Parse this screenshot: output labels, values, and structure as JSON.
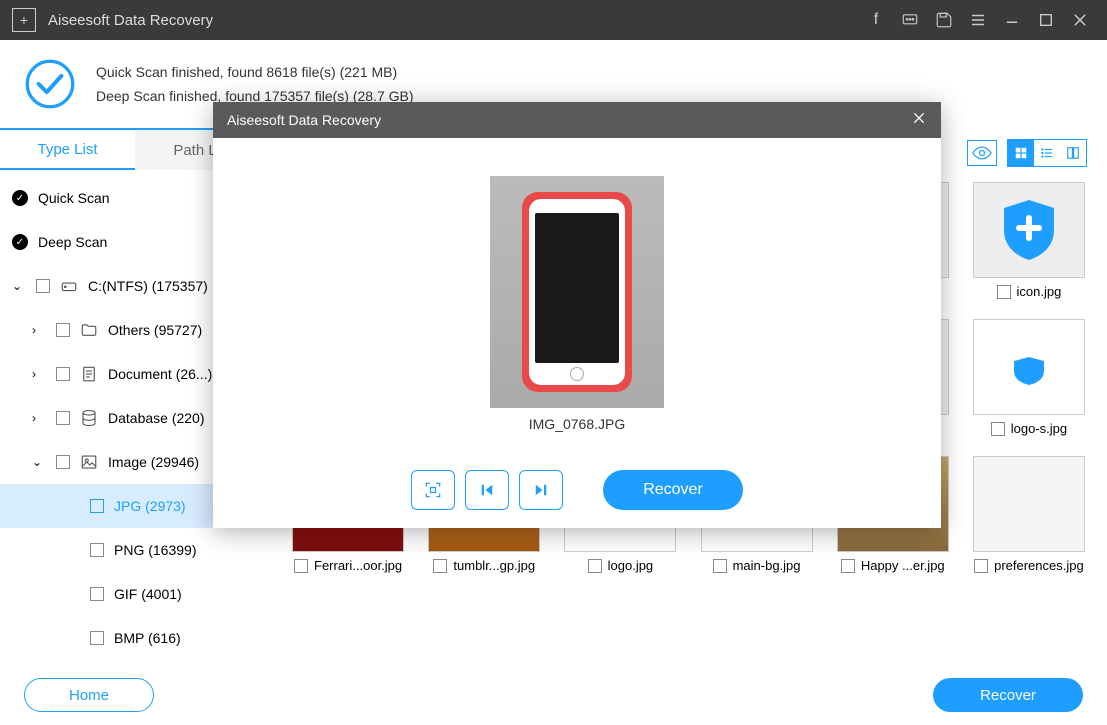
{
  "app": {
    "title": "Aiseesoft Data Recovery"
  },
  "status": {
    "quick": "Quick Scan finished, found 8618 file(s) (221 MB)",
    "deep": "Deep Scan finished, found 175357 file(s) (28.7 GB)"
  },
  "tabs": {
    "type_list": "Type List",
    "path_list": "Path List"
  },
  "tree": {
    "quick_scan": "Quick Scan",
    "deep_scan": "Deep Scan",
    "drive": "C:(NTFS) (175357)",
    "others": "Others (95727)",
    "document": "Document (26...)",
    "database": "Database (220)",
    "image": "Image (29946)",
    "jpg": "JPG (2973)",
    "png": "PNG (16399)",
    "gif": "GIF (4001)",
    "bmp": "BMP (616)"
  },
  "thumbs": [
    "icon.jpg",
    "logo-s.jpg",
    "Ferrari...oor.jpg",
    "tumblr...gp.jpg",
    "logo.jpg",
    "main-bg.jpg",
    "Happy ...er.jpg",
    "preferences.jpg"
  ],
  "footer": {
    "home": "Home",
    "recover": "Recover"
  },
  "modal": {
    "title": "Aiseesoft Data Recovery",
    "preview_name": "IMG_0768.JPG",
    "recover": "Recover"
  }
}
